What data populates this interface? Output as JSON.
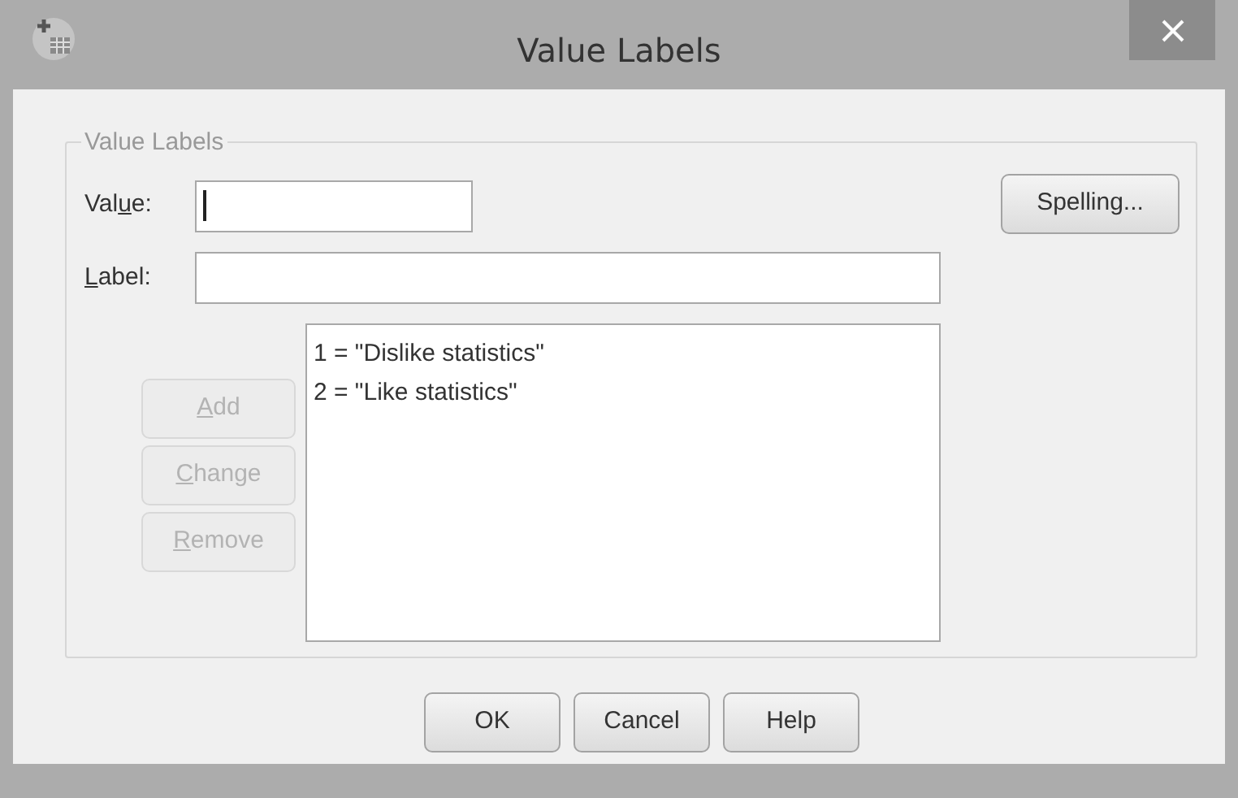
{
  "window": {
    "title": "Value Labels"
  },
  "group": {
    "title": "Value Labels"
  },
  "fields": [
    {
      "kind": "short",
      "label": {
        "before": "Val",
        "key": "u",
        "after": "e:"
      },
      "focused": true
    },
    {
      "kind": "long",
      "label": {
        "key": "L",
        "after": "abel:"
      },
      "focused": false
    }
  ],
  "spelling_button": "Spelling...",
  "list_buttons": [
    {
      "label": {
        "key": "A",
        "after": "dd"
      },
      "disabled": true
    },
    {
      "label": {
        "key": "C",
        "after": "hange"
      },
      "disabled": true
    },
    {
      "label": {
        "key": "R",
        "after": "emove"
      },
      "disabled": true
    }
  ],
  "value_list": [
    "1 = \"Dislike statistics\"",
    "2 = \"Like statistics\""
  ],
  "dialog_buttons": [
    "OK",
    "Cancel",
    "Help"
  ]
}
